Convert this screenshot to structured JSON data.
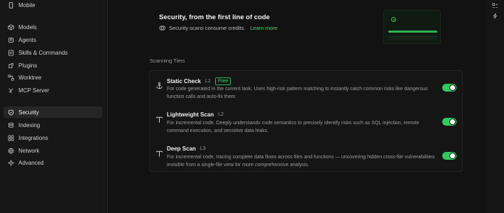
{
  "sidebar": {
    "items": [
      {
        "label": "Mobile",
        "icon": "mobile-icon"
      },
      {
        "label": "Models",
        "icon": "cube-icon"
      },
      {
        "label": "Agents",
        "icon": "agent-icon"
      },
      {
        "label": "Skills & Commands",
        "icon": "skills-icon"
      },
      {
        "label": "Plugins",
        "icon": "plugin-icon"
      },
      {
        "label": "Worktree",
        "icon": "worktree-icon"
      },
      {
        "label": "MCP Server",
        "icon": "server-icon"
      },
      {
        "label": "Security",
        "icon": "shield-icon",
        "active": true
      },
      {
        "label": "Indexing",
        "icon": "database-icon"
      },
      {
        "label": "Integrations",
        "icon": "integrations-icon"
      },
      {
        "label": "Network",
        "icon": "globe-icon"
      },
      {
        "label": "Advanced",
        "icon": "advanced-icon"
      }
    ]
  },
  "hero": {
    "title": "Security, from the first line of code",
    "subtitle": "Security scans consume credits.",
    "learn_more": "Learn more"
  },
  "scanning": {
    "section_title": "Scanning Tiers",
    "tiers": [
      {
        "name": "Static Check",
        "level": "L1",
        "badge": "Free",
        "description": "For code generated in the current task. Uses high-risk pattern matching to instantly catch common risks like dangerous function calls and auto-fix them.",
        "enabled": true,
        "icon": "anchor-icon"
      },
      {
        "name": "Lightweight Scan",
        "level": "L2",
        "description": "For incremental code. Deeply understands code semantics to precisely identify risks such as SQL injection, remote command execution, and sensitive data leaks.",
        "enabled": true,
        "icon": "scan-icon"
      },
      {
        "name": "Deep Scan",
        "level": "L3",
        "description": "For incremental code, tracing complete data flows across files and functions — uncovering hidden cross-file vulnerabilities invisible from a single-file view for more comprehensive analysis.",
        "enabled": true,
        "icon": "scan-icon"
      }
    ]
  },
  "colors": {
    "accent": "#2ecc5a",
    "background": "#121212"
  }
}
